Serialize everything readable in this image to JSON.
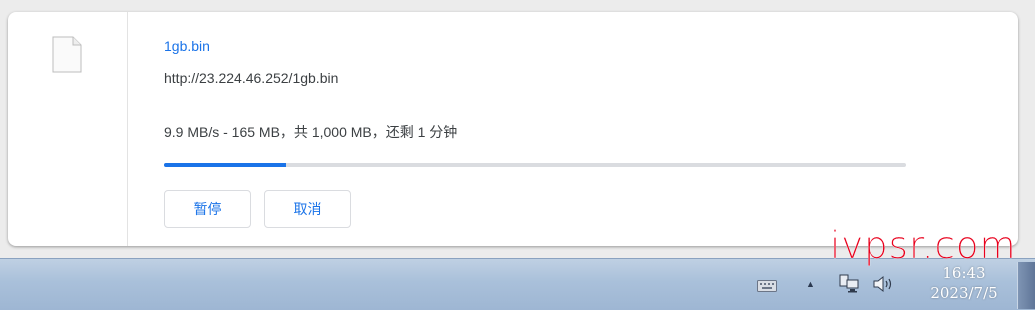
{
  "download": {
    "file_name": "1gb.bin",
    "url": "http://23.224.46.252/1gb.bin",
    "status": "9.9 MB/s - 165 MB，共 1,000 MB，还剩 1 分钟",
    "progress_fraction": 0.165,
    "pause_label": "暂停",
    "cancel_label": "取消"
  },
  "taskbar": {
    "time": "16:43",
    "date": "2023/7/5",
    "tray_icons": [
      "keyboard-icon",
      "show-hidden-icons-arrow",
      "network-icon",
      "volume-icon"
    ]
  },
  "watermark": {
    "text": "ivpsr.com"
  },
  "colors": {
    "link_blue": "#1a73e8",
    "progress_track": "#dadce0",
    "text": "#3c4043",
    "watermark_red": "#e8001c"
  }
}
